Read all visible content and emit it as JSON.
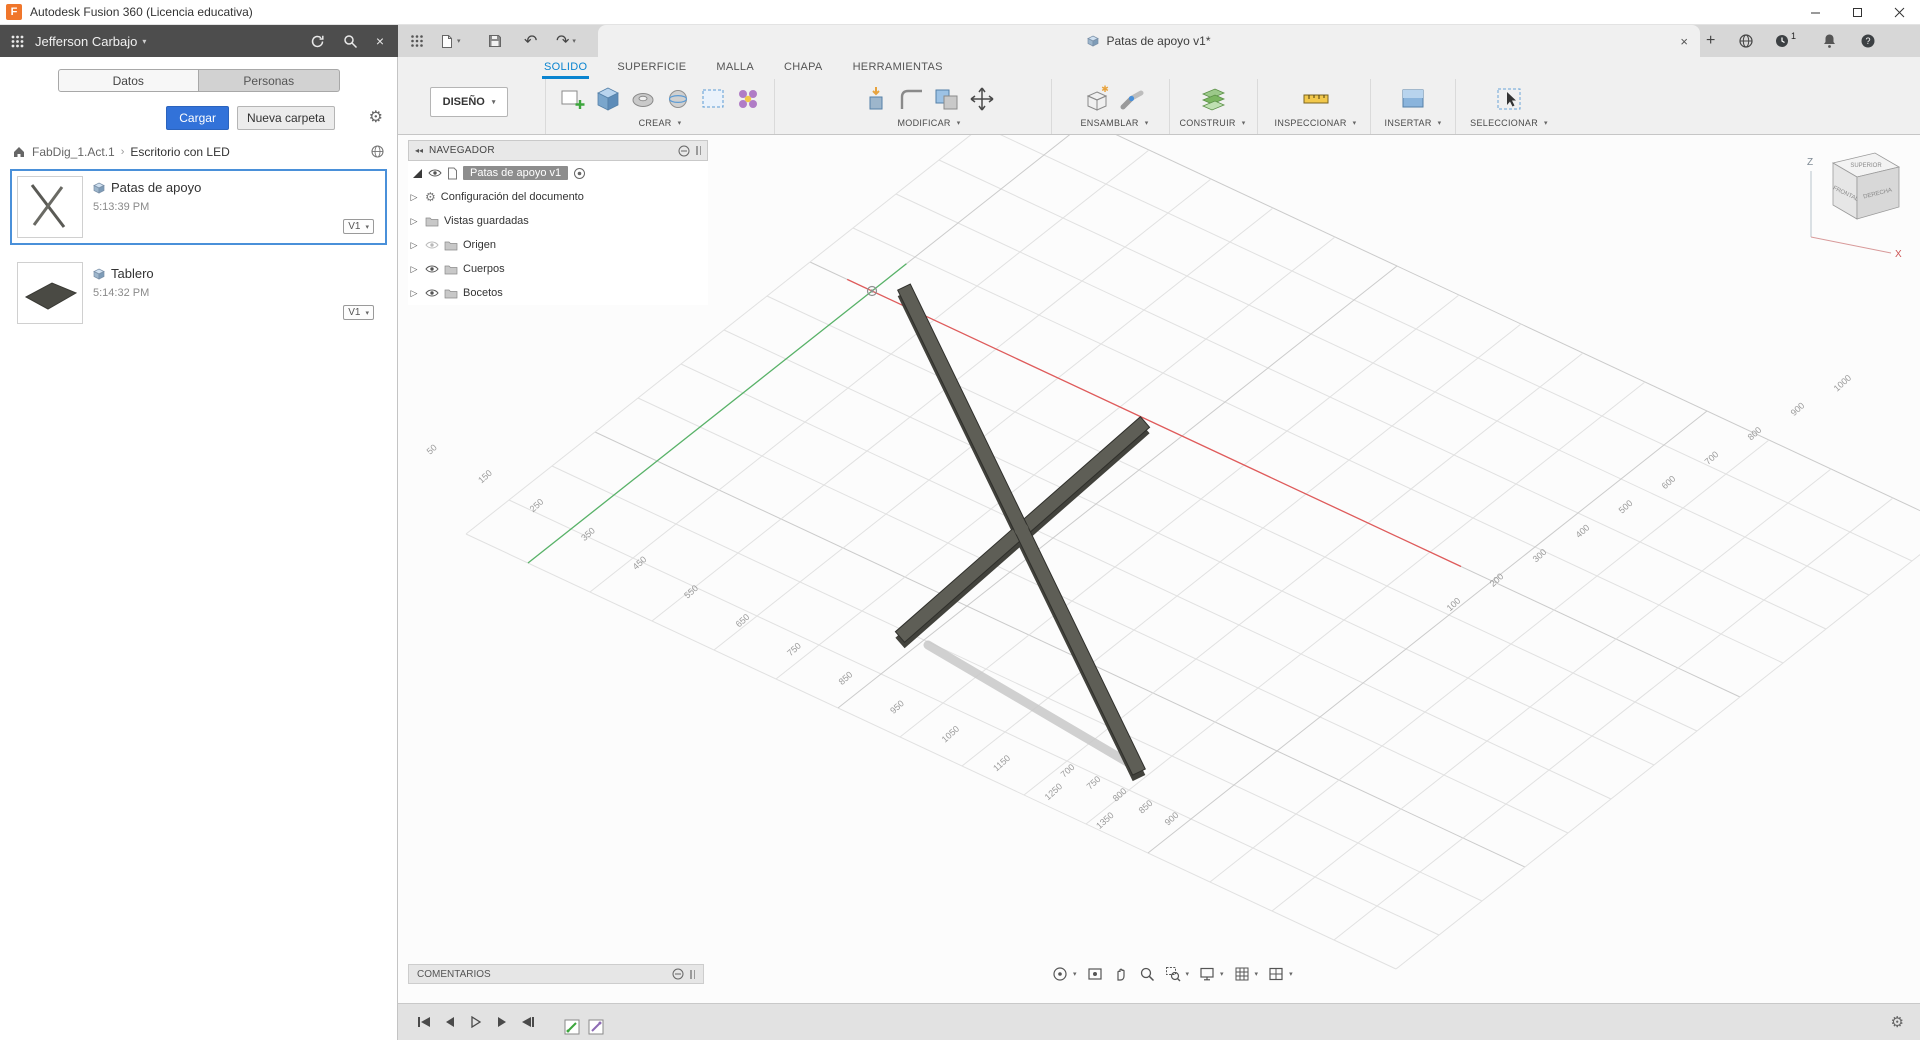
{
  "window": {
    "title": "Autodesk Fusion 360 (Licencia educativa)",
    "logo_letter": "F"
  },
  "data_panel": {
    "user_name": "Jefferson Carbajo",
    "tabs": [
      {
        "label": "Datos"
      },
      {
        "label": "Personas"
      }
    ],
    "upload_button": "Cargar",
    "new_folder_button": "Nueva carpeta",
    "breadcrumb": {
      "root": "FabDig_1.Act.1",
      "separator": "›",
      "current": "Escritorio con LED"
    },
    "items": [
      {
        "name": "Patas de apoyo",
        "time": "5:13:39 PM",
        "version": "V1"
      },
      {
        "name": "Tablero",
        "time": "5:14:32 PM",
        "version": "V1"
      }
    ]
  },
  "toolbar": {
    "document_tab": "Patas de apoyo v1*",
    "notifications_badge": "1"
  },
  "ribbon": {
    "workspace_button": "DISEÑO",
    "tabs": [
      "SOLIDO",
      "SUPERFICIE",
      "MALLA",
      "CHAPA",
      "HERRAMIENTAS"
    ],
    "groups": [
      "CREAR",
      "MODIFICAR",
      "ENSAMBLAR",
      "CONSTRUIR",
      "INSPECCIONAR",
      "INSERTAR",
      "SELECCIONAR"
    ]
  },
  "navigator": {
    "title": "NAVEGADOR",
    "document_node": "Patas de apoyo v1",
    "nodes": [
      "Configuración del documento",
      "Vistas guardadas",
      "Origen",
      "Cuerpos",
      "Bocetos"
    ]
  },
  "viewcube": {
    "top": "SUPERIOR",
    "front": "FRONTAL",
    "right": "DERECHA",
    "axis_z": "Z",
    "axis_x": "X"
  },
  "viewport": {
    "left_axis_labels": [
      "50",
      "150",
      "250",
      "350",
      "450",
      "550",
      "650",
      "750",
      "850",
      "950",
      "1050",
      "1150",
      "1250",
      "1350"
    ],
    "right_axis_labels": [
      "1000",
      "900",
      "800",
      "700",
      "600",
      "500",
      "400",
      "300",
      "200",
      "100"
    ],
    "bottom_axis_labels": [
      "700",
      "750",
      "800",
      "850",
      "900"
    ]
  },
  "comments": {
    "label": "COMENTARIOS"
  },
  "colors": {
    "accent_blue": "#0a84d0",
    "selection_blue": "#4a90d9",
    "axis_red": "#e05b5b",
    "axis_green": "#58b368",
    "model_gray": "#5e5e56",
    "upload_blue": "#3272d9"
  }
}
